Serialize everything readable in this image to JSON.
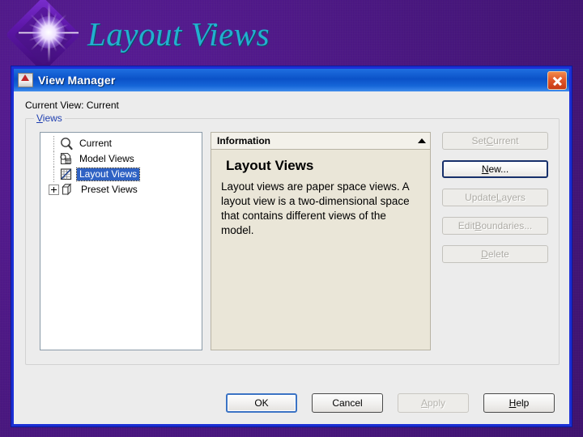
{
  "slide": {
    "title": "Layout Views",
    "background_color": "#4e1687",
    "title_color": "#22b0cf",
    "logo_icon": "diamond-starburst-logo"
  },
  "dialog": {
    "titlebar": {
      "title": "View Manager",
      "icon": "autocad-window-icon",
      "close_icon": "close-icon",
      "accent_color": "#0b52c8"
    },
    "current_view_label": "Current View: Current",
    "views_group": {
      "legend_prefix": "V",
      "legend_rest": "iews"
    },
    "tree": {
      "items": [
        {
          "label": "Current",
          "icon": "magnifier-icon",
          "selected": false,
          "has_expander": false
        },
        {
          "label": "Model Views",
          "icon": "model-views-icon",
          "selected": false,
          "has_expander": false
        },
        {
          "label": "Layout Views",
          "icon": "layout-views-icon",
          "selected": true,
          "has_expander": false
        },
        {
          "label": "Preset Views",
          "icon": "cube-icon",
          "selected": false,
          "has_expander": true
        }
      ],
      "selection_color": "#2f62c4"
    },
    "information": {
      "header": "Information",
      "collapse_icon": "chevron-up-icon",
      "title": "Layout Views",
      "text": "Layout views are paper space views.  A layout view is a two-dimensional space that contains different views of the model.",
      "background_color": "#eae6d8"
    },
    "side_buttons": [
      {
        "prefix": "Set ",
        "accel": "C",
        "suffix": "urrent",
        "state": "disabled"
      },
      {
        "prefix": "",
        "accel": "N",
        "suffix": "ew...",
        "state": "focused"
      },
      {
        "prefix": "Update ",
        "accel": "L",
        "suffix": "ayers",
        "state": "disabled"
      },
      {
        "prefix": "Edit ",
        "accel": "B",
        "suffix": "oundaries...",
        "state": "disabled"
      },
      {
        "prefix": "",
        "accel": "D",
        "suffix": "elete",
        "state": "disabled"
      }
    ],
    "bottom_buttons": [
      {
        "prefix": "OK",
        "accel": "",
        "suffix": "",
        "state": "default"
      },
      {
        "prefix": "Cancel",
        "accel": "",
        "suffix": "",
        "state": "normal"
      },
      {
        "prefix": "",
        "accel": "A",
        "suffix": "pply",
        "state": "disabled"
      },
      {
        "prefix": "",
        "accel": "H",
        "suffix": "elp",
        "state": "normal"
      }
    ]
  }
}
